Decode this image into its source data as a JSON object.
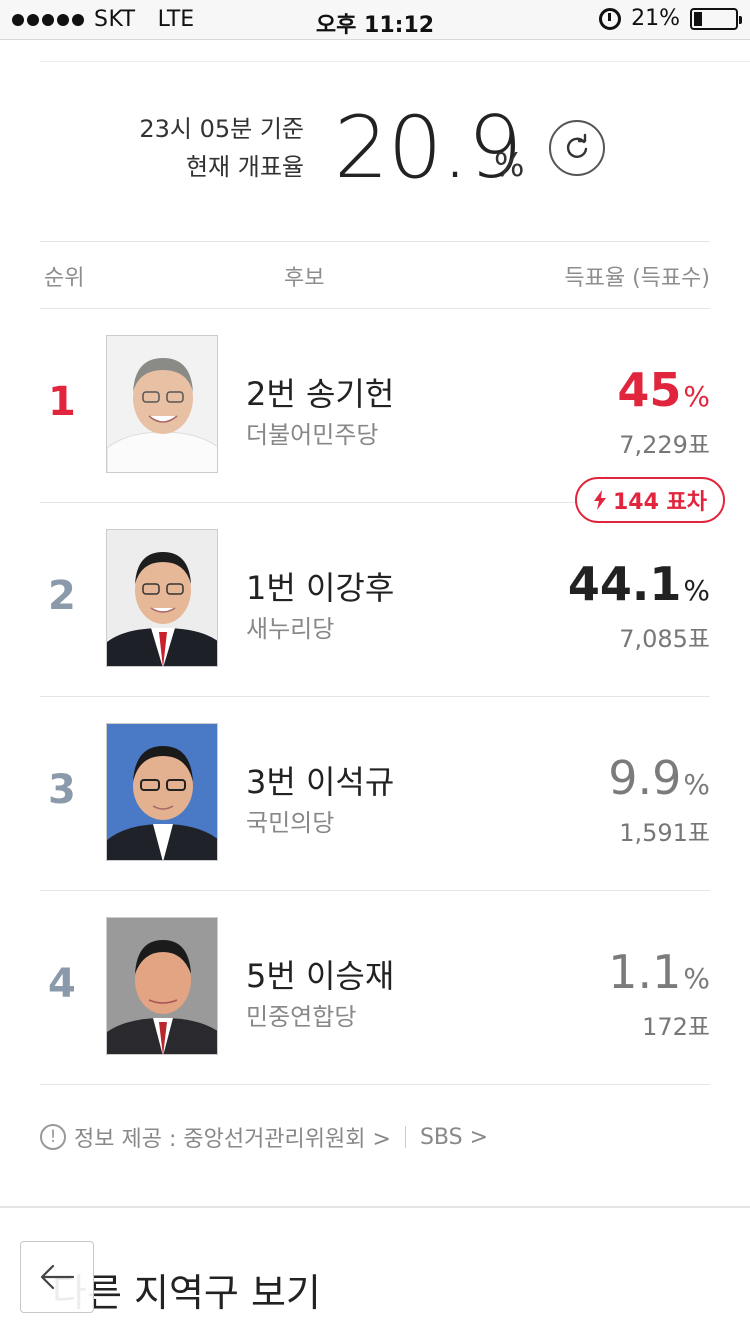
{
  "status_bar": {
    "carrier": "SKT",
    "network": "LTE",
    "time": "오후 11:12",
    "battery_text": "21%",
    "battery_level": 0.21
  },
  "header": {
    "time_basis": "23시 05분 기준",
    "count_label": "현재 개표율",
    "count_rate": "20.9",
    "count_rate_unit": "%"
  },
  "table": {
    "col_rank": "순위",
    "col_candidate": "후보",
    "col_rate": "득표율 (득표수)"
  },
  "candidates": [
    {
      "rank": "1",
      "name": "2번 송기헌",
      "party": "더불어민주당",
      "pct": "45",
      "votes": "7,229표"
    },
    {
      "rank": "2",
      "name": "1번 이강후",
      "party": "새누리당",
      "pct": "44.1",
      "votes": "7,085표"
    },
    {
      "rank": "3",
      "name": "3번 이석규",
      "party": "국민의당",
      "pct": "9.9",
      "votes": "1,591표"
    },
    {
      "rank": "4",
      "name": "5번 이승재",
      "party": "민중연합당",
      "pct": "1.1",
      "votes": "172표"
    }
  ],
  "pct_unit": "%",
  "gap_badge": "144 표차",
  "footer": {
    "source": "정보 제공 : 중앙선거관리위원회 >",
    "sbs": "SBS >"
  },
  "bottom": {
    "other_region": "다른 지역구 보기"
  },
  "colors": {
    "accent_red": "#e1253c",
    "rank_gray": "#8a9aaa"
  }
}
